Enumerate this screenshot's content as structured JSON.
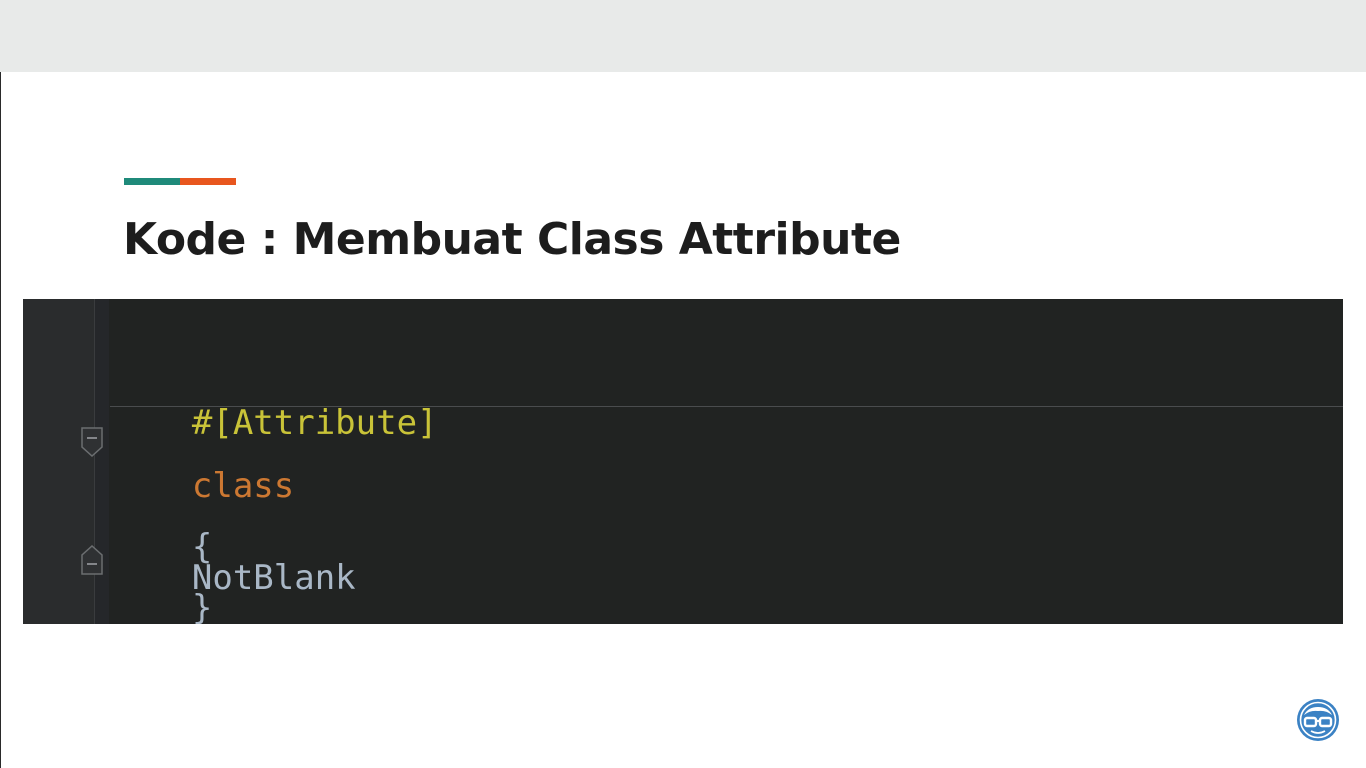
{
  "slide": {
    "title": "Kode : Membuat Class Attribute"
  },
  "accent": {
    "primary": "#1f8a7a",
    "secondary": "#e8561e"
  },
  "code": {
    "lines": [
      {
        "text": "#[Attribute]",
        "color": "#c9c338"
      },
      {
        "keyword": "class",
        "keyword_color": "#cc7832",
        "name": "NotBlank",
        "name_color": "#a9b7c6"
      },
      {
        "text": "{",
        "color": "#a9b7c6"
      },
      {
        "text": "}",
        "color": "#a9b7c6"
      }
    ]
  },
  "icons": {
    "fold_open": "fold-collapse-icon",
    "fold_close": "fold-end-icon",
    "logo": "nerd-glasses-logo-icon"
  },
  "logo": {
    "circle_color": "#3b82c4"
  }
}
